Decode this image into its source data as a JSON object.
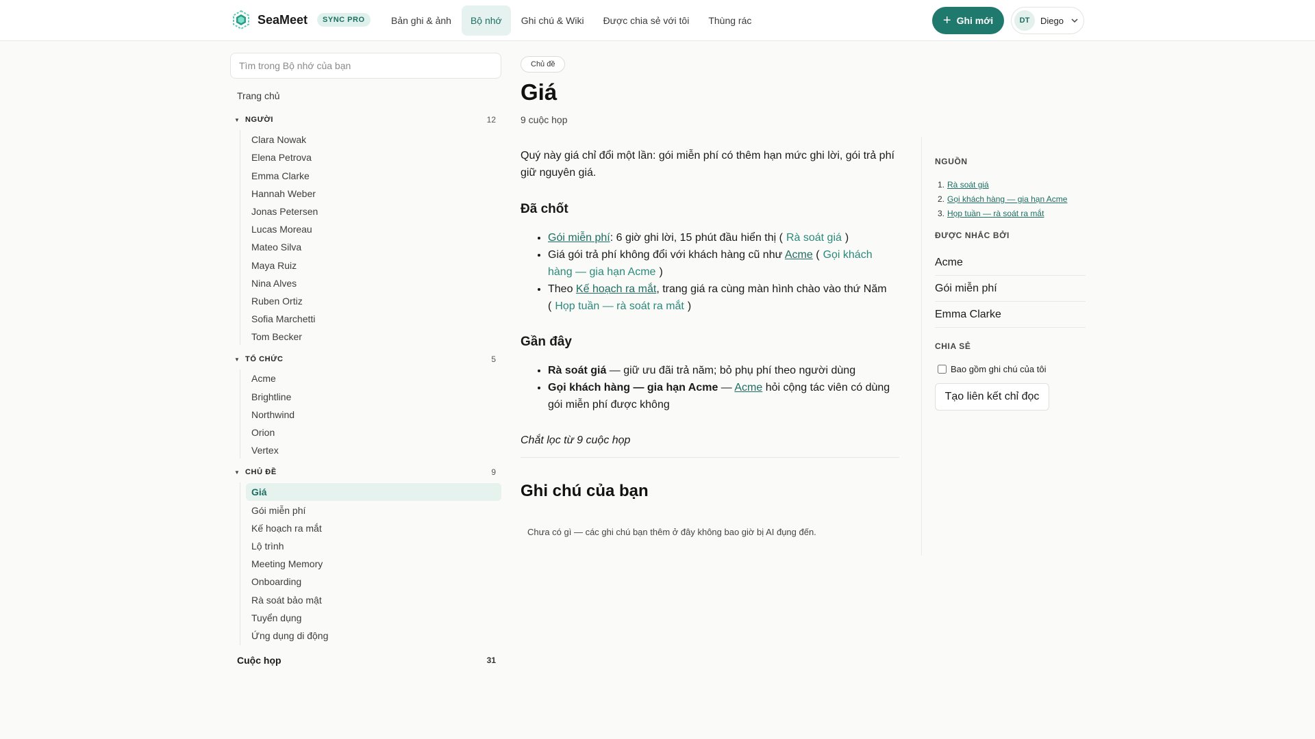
{
  "app": {
    "name": "SeaMeet",
    "plan_badge": "SYNC PRO",
    "logo_icon": "seamless-hexagon-logo",
    "accent_color": "#1f7a6d"
  },
  "nav": {
    "tabs": [
      {
        "label": "Bản ghi & ảnh",
        "active": false
      },
      {
        "label": "Bộ nhớ",
        "active": true
      },
      {
        "label": "Ghi chú & Wiki",
        "active": false
      },
      {
        "label": "Được chia sẻ với tôi",
        "active": false
      },
      {
        "label": "Thùng rác",
        "active": false
      }
    ]
  },
  "header": {
    "new_button_label": "Ghi mới",
    "user_initials": "DT",
    "user_name": "Diego"
  },
  "sidebar": {
    "search_placeholder": "Tìm trong Bộ nhớ của bạn",
    "home_label": "Trang chủ",
    "people": {
      "label": "NGƯỜI",
      "count": "12",
      "items": [
        "Clara Nowak",
        "Elena Petrova",
        "Emma Clarke",
        "Hannah Weber",
        "Jonas Petersen",
        "Lucas Moreau",
        "Mateo Silva",
        "Maya Ruiz",
        "Nina Alves",
        "Ruben Ortiz",
        "Sofia Marchetti",
        "Tom Becker"
      ]
    },
    "orgs": {
      "label": "TỔ CHỨC",
      "count": "5",
      "items": [
        "Acme",
        "Brightline",
        "Northwind",
        "Orion",
        "Vertex"
      ]
    },
    "topics": {
      "label": "CHỦ ĐỀ",
      "count": "9",
      "active_item": "Giá",
      "items": [
        "Giá",
        "Gói miễn phí",
        "Kế hoạch ra mắt",
        "Lộ trình",
        "Meeting Memory",
        "Onboarding",
        "Rà soát bảo mật",
        "Tuyển dụng",
        "Ứng dụng di động"
      ]
    },
    "meetings": {
      "label": "Cuộc họp",
      "count": "31"
    }
  },
  "main": {
    "chip": "Chủ đề",
    "title": "Giá",
    "meeting_count": "9 cuộc họp",
    "lead": "Quý này giá chỉ đổi một lần: gói miễn phí có thêm hạn mức ghi lời, gói trả phí giữ nguyên giá.",
    "decided": {
      "heading": "Đã chốt",
      "b1_link": "Gói miễn phí",
      "b1_text": ": 6 giờ ghi lời, 15 phút đầu hiển thị (",
      "b1_cite": "Rà soát giá",
      "b1_close": ")",
      "b2_text": "Giá gói trả phí không đổi với khách hàng cũ như ",
      "b2_link": "Acme",
      "b2_open": " (",
      "b2_cite": "Gọi khách hàng — gia hạn Acme",
      "b2_close": ")",
      "b3_pre": "Theo ",
      "b3_link": "Kế hoạch ra mắt",
      "b3_text": ", trang giá ra cùng màn hình chào vào thứ Năm (",
      "b3_cite": "Họp tuần — rà soát ra mắt",
      "b3_close": ")"
    },
    "recent": {
      "heading": "Gần đây",
      "r1_bold": "Rà soát giá",
      "r1_text": " — giữ ưu đãi trả năm; bỏ phụ phí theo người dùng",
      "r2_bold": "Gọi khách hàng — gia hạn Acme",
      "r2_dash": " — ",
      "r2_link": "Acme",
      "r2_text": " hỏi cộng tác viên có dùng gói miễn phí được không"
    },
    "distilled": "Chắt lọc từ 9 cuộc họp",
    "notes_title": "Ghi chú của bạn",
    "notes_empty": "Chưa có gì — các ghi chú bạn thêm ở đây không bao giờ bị AI đụng đến."
  },
  "rail": {
    "sources_heading": "NGUỒN",
    "sources": [
      {
        "num": "1.",
        "label": "Rà soát giá"
      },
      {
        "num": "2.",
        "label": "Gọi khách hàng — gia hạn Acme"
      },
      {
        "num": "3.",
        "label": "Họp tuần — rà soát ra mắt"
      }
    ],
    "mentioned_heading": "ĐƯỢC NHẮC BỞI",
    "mentioned": [
      "Acme",
      "Gói miễn phí",
      "Emma Clarke"
    ],
    "share_heading": "CHIA SẺ",
    "share_checkbox_label": "Bao gồm ghi chú của tôi",
    "share_button_label": "Tạo liên kết chỉ đọc"
  }
}
